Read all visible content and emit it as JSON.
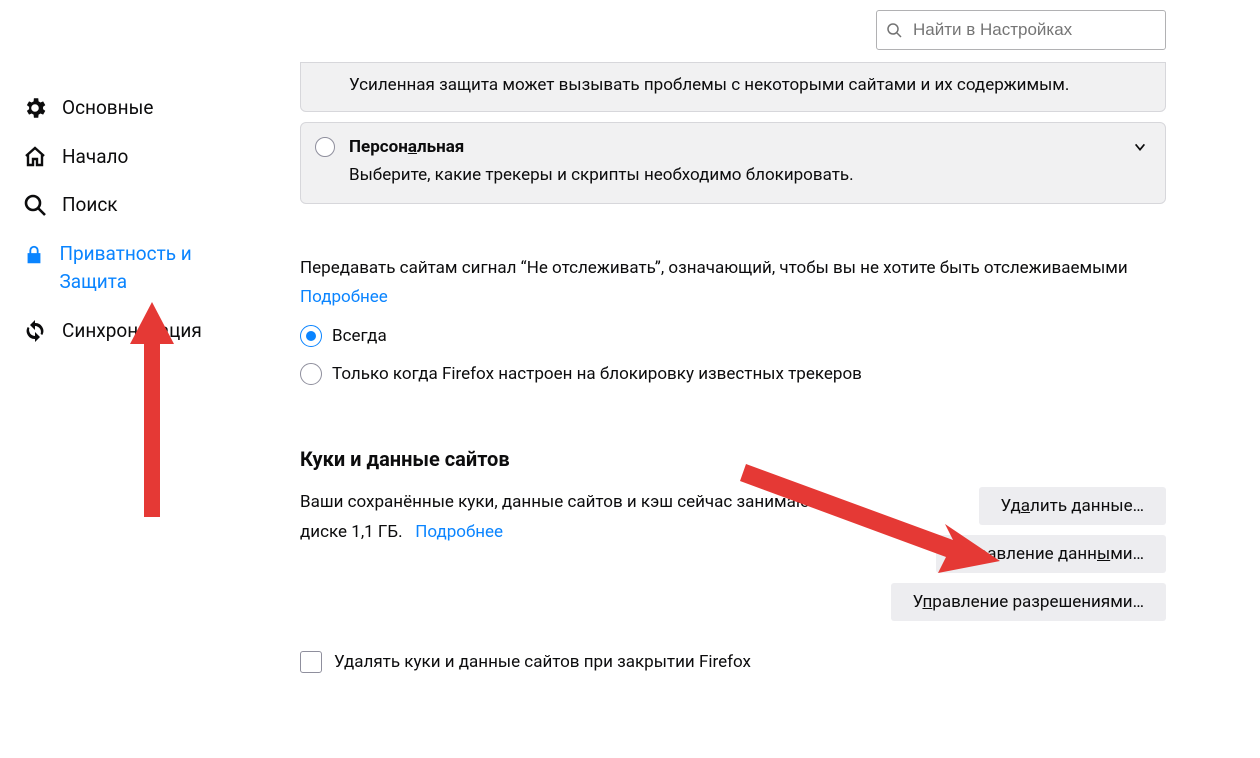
{
  "search": {
    "placeholder": "Найти в Настройках"
  },
  "sidebar": {
    "items": [
      {
        "label": "Основные"
      },
      {
        "label": "Начало"
      },
      {
        "label": "Поиск"
      },
      {
        "label": "Приватность и Защита"
      },
      {
        "label": "Синхронизация"
      }
    ]
  },
  "main": {
    "strict_protection_note": "Усиленная защита может вызывать проблемы с некоторыми сайтами и их содержимым.",
    "custom_title_pre": "Персон",
    "custom_title_u": "а",
    "custom_title_post": "льная",
    "custom_desc": "Выберите, какие трекеры и скрипты необходимо блокировать.",
    "dnt_text": "Передавать сайтам сигнал “Не отслеживать”, означающий, чтобы вы не хотите быть отслеживаемыми",
    "learn_more": "Подробнее",
    "dnt_options": {
      "always": "Всегда",
      "when_blocking": "Только когда Firefox настроен на блокировку известных трекеров"
    },
    "cookies": {
      "title": "Куки и данные сайтов",
      "desc_pre": "Ваши сохранённые куки, данные сайтов и кэш сейчас занимают на диске ",
      "size": "1,1 ГБ",
      "desc_post": ".",
      "learn_more": "Подробнее",
      "clear_btn_pre": "Уд",
      "clear_btn_u": "а",
      "clear_btn_post": "лить данные…",
      "manage_btn_pre": "Управление данн",
      "manage_btn_u": "ы",
      "manage_btn_post": "ми…",
      "perm_btn_pre": "У",
      "perm_btn_u": "п",
      "perm_btn_post": "равление разрешениями…",
      "delete_on_close": "Удалять куки и данные сайтов при закрытии Firefox"
    }
  }
}
